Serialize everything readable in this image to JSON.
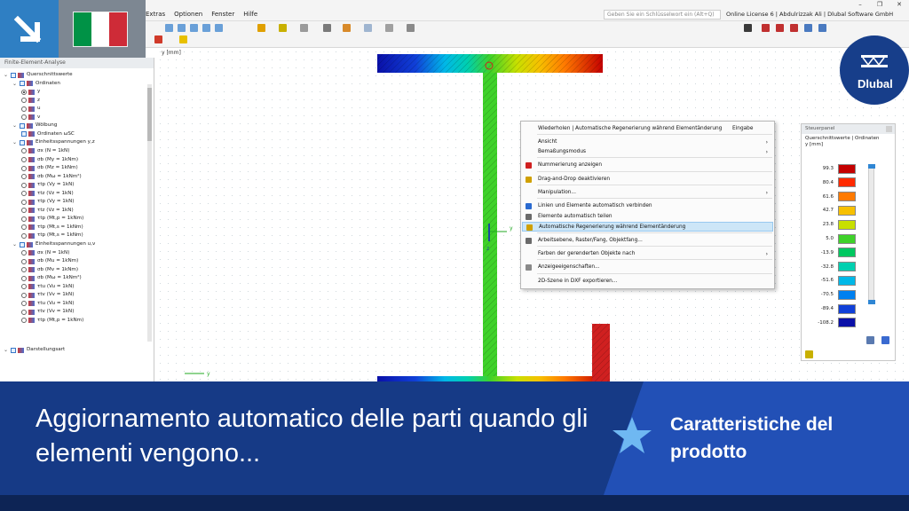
{
  "menu": {
    "items": [
      "Extras",
      "Optionen",
      "Fenster",
      "Hilfe"
    ],
    "search_placeholder": "Geben Sie ein Schlüsselwort ein (Alt+Q)",
    "license": "Online License 6 | Abdulrizzak Ali | Dlubal Software GmbH"
  },
  "navigator": {
    "title": "Finite-Element-Analyse",
    "items": [
      "Querschnittswerte",
      "Ordinaten",
      "y",
      "z",
      "u",
      "v",
      "Wölbung",
      "Ordinaten ωSC",
      "Einheitsspannungen y,z",
      "σx (N = 1kN)",
      "σb (My = 1kNm)",
      "σb (Mz = 1kNm)",
      "σb (Mω = 1kNm²)",
      "τtp (Vy = 1kN)",
      "τtz (Vz = 1kN)",
      "τtp (Vy = 1kN)",
      "τtz (Vz = 1kN)",
      "τtp (Mt,p = 1kNm)",
      "τtp (Mt,s = 1kNm)",
      "τtp (Mt,s = 1kNm)",
      "Einheitsspannungen u,v",
      "σx (N = 1kN)",
      "σb (Mu = 1kNm)",
      "σb (Mv = 1kNm)",
      "σb (Mω = 1kNm²)",
      "τtu (Vu = 1kN)",
      "τtv (Vv = 1kN)",
      "τtu (Vu = 1kN)",
      "τtv (Vv = 1kN)",
      "τtp (Mt,p = 1kNm)",
      "Darstellungsart"
    ]
  },
  "canvas": {
    "axis_unit": "y [mm]",
    "axis_y": "y",
    "axis_z": "z"
  },
  "context_menu": {
    "items": [
      {
        "label": "Wiederholen | Automatische Regenerierung während Elementänderung",
        "shortcut": "Eingabe"
      },
      {
        "label": "Ansicht",
        "submenu": true
      },
      {
        "label": "Bemaßungsmodus",
        "submenu": true
      },
      {
        "label": "Nummerierung anzeigen"
      },
      {
        "label": "Drag-and-Drop deaktivieren"
      },
      {
        "label": "Manipulation...",
        "submenu": true
      },
      {
        "label": "Linien und Elemente automatisch verbinden"
      },
      {
        "label": "Elemente automatisch teilen"
      },
      {
        "label": "Automatische Regenerierung während Elementänderung",
        "highlighted": true
      },
      {
        "label": "Arbeitsebene, Raster/Fang, Objektfang..."
      },
      {
        "label": "Farben der gerenderten Objekte nach",
        "submenu": true
      },
      {
        "label": "Anzeigeeigenschaften..."
      },
      {
        "label": "2D-Szene in DXF exportieren..."
      }
    ]
  },
  "control_panel": {
    "title": "Steuerpanel",
    "subtitle": "Querschnittswerte | Ordinaten",
    "unit": "y [mm]",
    "legend": [
      {
        "value": "99.3",
        "color": "#c40000"
      },
      {
        "value": "80.4",
        "color": "#ff2a00"
      },
      {
        "value": "61.6",
        "color": "#ff7a00"
      },
      {
        "value": "42.7",
        "color": "#f7c000"
      },
      {
        "value": "23.8",
        "color": "#c8e000"
      },
      {
        "value": "5.0",
        "color": "#3fd22a"
      },
      {
        "value": "-13.9",
        "color": "#00c860"
      },
      {
        "value": "-32.8",
        "color": "#00d0b0"
      },
      {
        "value": "-51.6",
        "color": "#00b8e8"
      },
      {
        "value": "-70.5",
        "color": "#0080f0"
      },
      {
        "value": "-89.4",
        "color": "#1040d8"
      },
      {
        "value": "-108.2",
        "color": "#0a10a8"
      }
    ]
  },
  "brand": {
    "name": "Dlubal"
  },
  "banner": {
    "title": "Aggiornamento automatico delle parti quando gli elementi vengono...",
    "tag": "Caratteristiche del prodotto"
  },
  "flag_colors": [
    "#009246",
    "#ffffff",
    "#ce2b37"
  ]
}
